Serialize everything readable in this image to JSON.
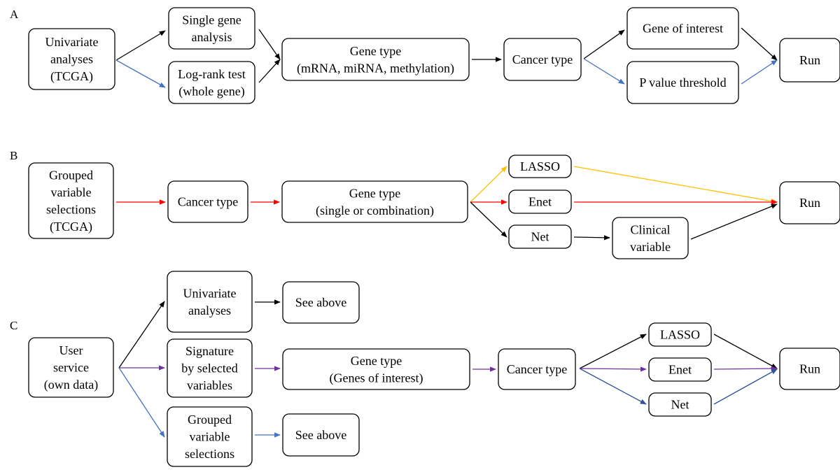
{
  "panels": [
    {
      "label": "A",
      "boxes": {
        "a1": [
          "Univariate",
          "analyses",
          "(TCGA)"
        ],
        "a2": [
          "Single gene",
          "analysis"
        ],
        "a3": [
          "Log-rank test",
          "(whole gene)"
        ],
        "a4": [
          "Gene type",
          "(mRNA, miRNA, methylation)"
        ],
        "a5": [
          "Cancer type"
        ],
        "a6": [
          "Gene of interest"
        ],
        "a7": [
          "P value threshold"
        ],
        "a8": [
          "Run"
        ]
      }
    },
    {
      "label": "B",
      "boxes": {
        "b1": [
          "Grouped",
          "variable",
          "selections",
          "(TCGA)"
        ],
        "b2": [
          "Cancer type"
        ],
        "b3": [
          "Gene type",
          "(single or combination)"
        ],
        "b4": [
          "LASSO"
        ],
        "b5": [
          "Enet"
        ],
        "b6": [
          "Net"
        ],
        "b7": [
          "Clinical",
          "variable"
        ],
        "b8": [
          "Run"
        ]
      }
    },
    {
      "label": "C",
      "boxes": {
        "c1": [
          "User",
          "service",
          "(own data)"
        ],
        "c2": [
          "Univariate",
          "analyses"
        ],
        "c3": [
          "See above"
        ],
        "c4": [
          "Signature",
          "by selected",
          "variables"
        ],
        "c5": [
          "Gene type",
          "(Genes of interest)"
        ],
        "c6": [
          "Cancer type"
        ],
        "c7": [
          "LASSO"
        ],
        "c8": [
          "Enet"
        ],
        "c9": [
          "Net"
        ],
        "c10": [
          "Run"
        ],
        "c11": [
          "Grouped",
          "variable",
          "selections"
        ],
        "c12": [
          "See above"
        ]
      }
    }
  ],
  "colors": {
    "black": "#000000",
    "blue": "#4472c4",
    "red": "#ff0000",
    "yellow": "#ffc000",
    "purple": "#7030a0",
    "navy": "#2f5597"
  }
}
